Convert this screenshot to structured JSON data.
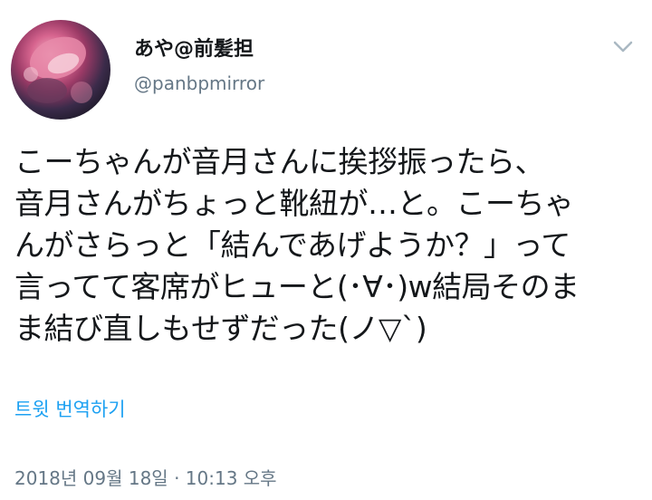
{
  "author": {
    "display_name": "あや@前髪担",
    "handle": "@panbpmirror",
    "avatar_icon": "avatar-photo"
  },
  "menu": {
    "icon": "chevron-down-icon",
    "color": "#aab8c2"
  },
  "tweet": {
    "lines": [
      "こーちゃんが音月さんに挨拶振ったら、",
      "音月さんがちょっと靴紐が…と。こーちゃ",
      "んがさらっと「結んであげようか？」って",
      "言ってて客席がヒューと(･∀･)w結局そのま",
      "ま結び直しもせずだった(ノ▽`)"
    ]
  },
  "translate_label": "트윗 번역하기",
  "timestamp": "2018년 09월 18일 · 10:13 오후",
  "colors": {
    "link": "#1da1f2",
    "secondary_text": "#657786",
    "primary_text": "#14171a"
  }
}
